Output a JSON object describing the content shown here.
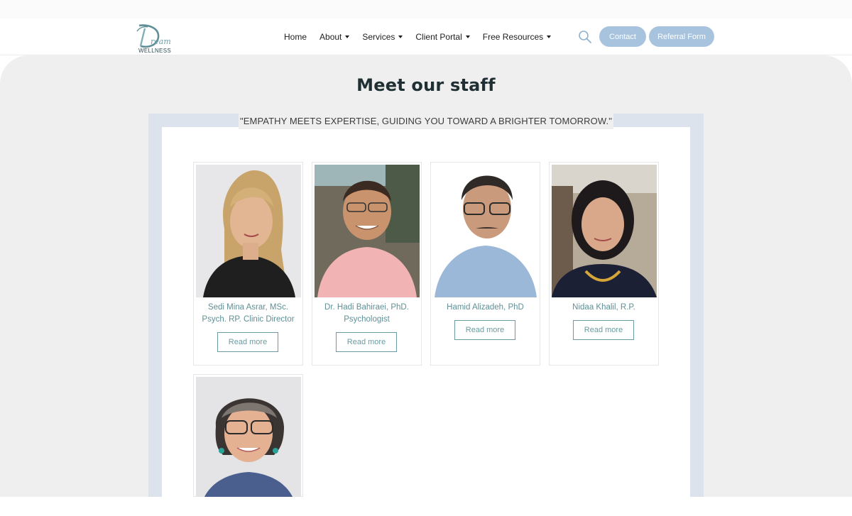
{
  "brand": {
    "script": "ream",
    "word": "WELLNESS"
  },
  "nav": {
    "items": [
      {
        "label": "Home",
        "dropdown": false
      },
      {
        "label": "About",
        "dropdown": true
      },
      {
        "label": "Services",
        "dropdown": true
      },
      {
        "label": "Client Portal",
        "dropdown": true
      },
      {
        "label": "Free Resources",
        "dropdown": true
      }
    ],
    "contact_label": "Contact",
    "referral_label": "Referral Form"
  },
  "main": {
    "title": "Meet our staff",
    "tagline": "\"EMPATHY MEETS EXPERTISE, GUIDING YOU TOWARD A BRIGHTER TOMORROW.\""
  },
  "staff": [
    {
      "name_lines": [
        "Sedi Mina Asrar, MSc.",
        "Psych. RP. Clinic Director"
      ],
      "read_more": "Read more"
    },
    {
      "name_lines": [
        "Dr. Hadi Bahiraei, PhD.",
        "Psychologist"
      ],
      "read_more": "Read more"
    },
    {
      "name_lines": [
        "Hamid Alizadeh, PhD"
      ],
      "read_more": "Read more"
    },
    {
      "name_lines": [
        "Nidaa Khalil, R.P."
      ],
      "read_more": "Read more"
    },
    {
      "name_lines": [],
      "read_more": ""
    }
  ],
  "colors": {
    "accent": "#a8c3dd",
    "name_text": "#5f9095",
    "button_border": "#6a9ba0",
    "section_bg": "#efefef",
    "frame": "#dde3ec"
  }
}
